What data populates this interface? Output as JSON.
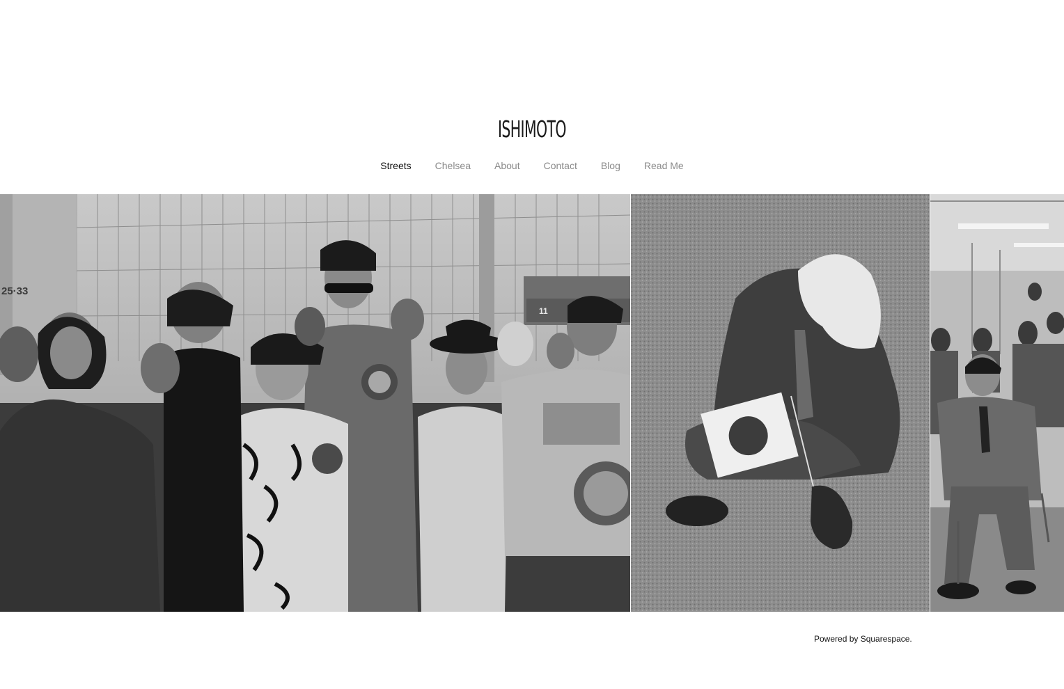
{
  "site": {
    "logo_text": "ISHIMOTO"
  },
  "nav": {
    "items": [
      {
        "label": "Streets",
        "active": true
      },
      {
        "label": "Chelsea",
        "active": false
      },
      {
        "label": "About",
        "active": false
      },
      {
        "label": "Contact",
        "active": false
      },
      {
        "label": "Blog",
        "active": false
      },
      {
        "label": "Read Me",
        "active": false
      }
    ]
  },
  "gallery": {
    "photos": [
      {
        "description": "crowd of stylish young people on a Tokyo street",
        "signage_left": "25·33",
        "signage_right": "11"
      },
      {
        "description": "man in suit sitting on grass with Japanese flag"
      },
      {
        "description": "seated men in suits in a meeting room"
      }
    ]
  },
  "footer": {
    "powered_by": "Powered by ",
    "link_label": "Squarespace",
    "period": "."
  },
  "colors": {
    "text_active": "#111111",
    "text_inactive": "#8a8a8a",
    "background": "#ffffff"
  }
}
